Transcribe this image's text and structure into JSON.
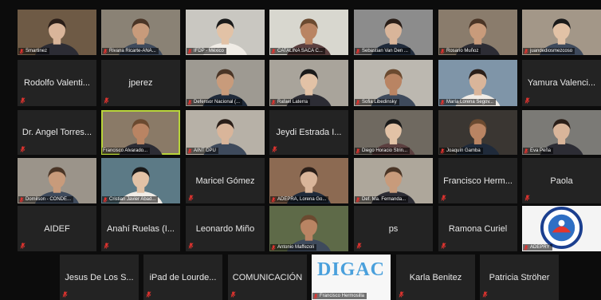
{
  "meeting": {
    "participants": [
      {
        "name": "Smartinez",
        "kind": "video",
        "bg": "#6e5a45",
        "muted": true
      },
      {
        "name": "Rivana Ricarte-ANA...",
        "kind": "video",
        "bg": "#8a8275",
        "muted": true
      },
      {
        "name": "IFDP - México",
        "kind": "video",
        "bg": "#c9c7c1",
        "muted": true
      },
      {
        "name": "CATALINA SACA C...",
        "kind": "video",
        "bg": "#d8d7cf",
        "muted": true
      },
      {
        "name": "Sebastian Van Den ...",
        "kind": "video",
        "bg": "#8c8c8c",
        "muted": true
      },
      {
        "name": "Rosario Muñoz",
        "kind": "video",
        "bg": "#8a7c6c",
        "muted": true
      },
      {
        "name": "juandediosmezcoso",
        "kind": "video",
        "bg": "#a39788",
        "muted": true
      },
      {
        "name": "Rodolfo Valenti...",
        "kind": "name",
        "muted": true
      },
      {
        "name": "jperez",
        "kind": "name",
        "muted": true
      },
      {
        "name": "Defensor Nacional (...",
        "kind": "video",
        "bg": "#9e9a92",
        "muted": true
      },
      {
        "name": "Rafael Laterra",
        "kind": "video",
        "bg": "#a9a49b",
        "muted": true
      },
      {
        "name": "Sofia Libedinsky",
        "kind": "video",
        "bg": "#bcb8b0",
        "muted": true
      },
      {
        "name": "María Lorena Segov...",
        "kind": "video",
        "bg": "#7f95a8",
        "muted": true
      },
      {
        "name": "Yamura Valenci...",
        "kind": "name",
        "muted": true
      },
      {
        "name": "Dr. Angel Torres...",
        "kind": "name",
        "muted": true
      },
      {
        "name": "Francisco Alvarado...",
        "kind": "video",
        "bg": "#8a7a67",
        "muted": false,
        "active": true
      },
      {
        "name": "AINT DPU",
        "kind": "video",
        "bg": "#b7b1a7",
        "muted": true
      },
      {
        "name": "Jeydi Estrada I...",
        "kind": "name",
        "muted": true
      },
      {
        "name": "Diego Horacio Strin...",
        "kind": "video",
        "bg": "#6f6960",
        "muted": true
      },
      {
        "name": "Joaquín Gamba",
        "kind": "video",
        "bg": "#3a3632",
        "muted": true
      },
      {
        "name": "Eva Peña",
        "kind": "video",
        "bg": "#7b7a76",
        "muted": true
      },
      {
        "name": "Domilson - CONDE...",
        "kind": "video",
        "bg": "#9b948a",
        "muted": true
      },
      {
        "name": "Cristian Javier Abad...",
        "kind": "video",
        "bg": "#5c7a86",
        "muted": true
      },
      {
        "name": "Maricel Gómez",
        "kind": "name",
        "muted": true
      },
      {
        "name": "ADEPRA, Lorena Go...",
        "kind": "video",
        "bg": "#8c6a52",
        "muted": true
      },
      {
        "name": "Def. Ma. Fernanda...",
        "kind": "video",
        "bg": "#aea79b",
        "muted": true
      },
      {
        "name": "Francisco Herm...",
        "kind": "name",
        "muted": true
      },
      {
        "name": "Paola",
        "kind": "name",
        "muted": true
      },
      {
        "name": "AIDEF",
        "kind": "name",
        "muted": true
      },
      {
        "name": "Anahí Ruelas (I...",
        "kind": "name",
        "muted": true
      },
      {
        "name": "Leonardo Miño",
        "kind": "name",
        "muted": true
      },
      {
        "name": "Antonio Maffezoli",
        "kind": "video",
        "bg": "#5e6a48",
        "muted": true
      },
      {
        "name": "ps",
        "kind": "name",
        "muted": true
      },
      {
        "name": "Ramona Curiel",
        "kind": "name",
        "muted": true
      },
      {
        "name": "ADEPRY",
        "kind": "logo",
        "muted": true
      },
      {
        "name": "Jesus De Los S...",
        "kind": "name",
        "muted": true
      },
      {
        "name": "iPad de Lourde...",
        "kind": "name",
        "muted": true
      },
      {
        "name": "COMUNICACIÓN",
        "kind": "name",
        "muted": true
      },
      {
        "name": "Francisco Hermosilla",
        "kind": "digac",
        "logo_text": "DIGAC",
        "muted": true
      },
      {
        "name": "Karla Benitez",
        "kind": "name",
        "muted": true
      },
      {
        "name": "Patricia Ströher",
        "kind": "name",
        "muted": true
      }
    ]
  }
}
